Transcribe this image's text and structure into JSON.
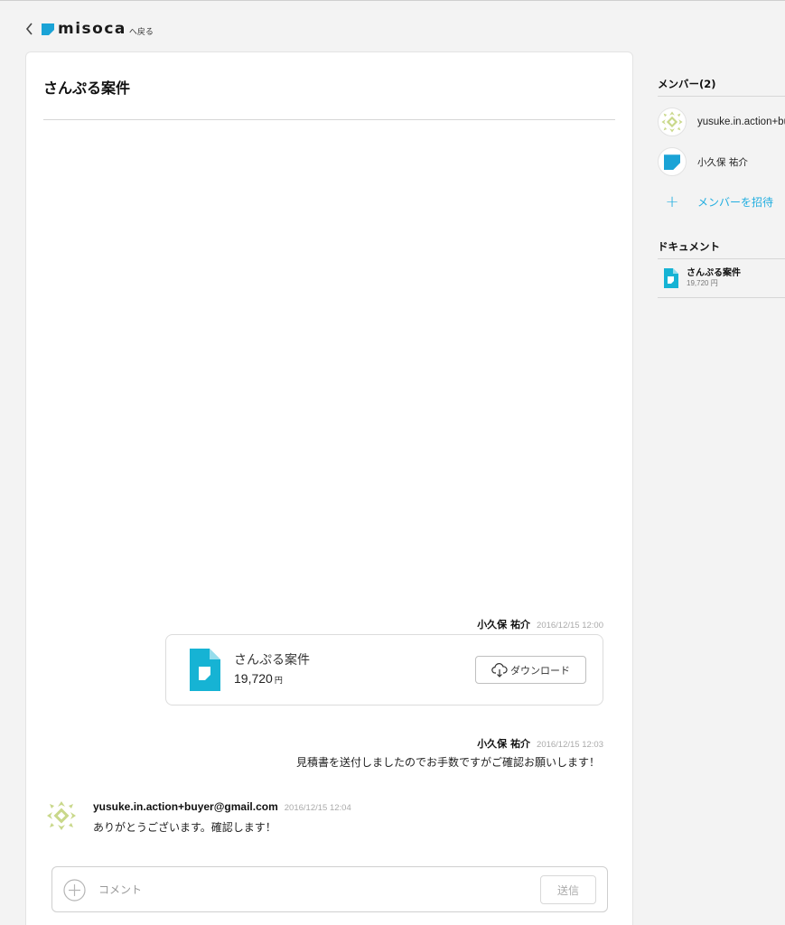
{
  "header": {
    "logo_text": "misoca",
    "back_label": "へ戻る"
  },
  "project": {
    "title": "さんぷる案件"
  },
  "messages": [
    {
      "author": "小久保 祐介",
      "timestamp": "2016/12/15 12:00",
      "attachment": {
        "name": "さんぷる案件",
        "amount": "19,720",
        "currency": "円",
        "download_label": "ダウンロード"
      }
    },
    {
      "author": "小久保 祐介",
      "timestamp": "2016/12/15 12:03",
      "text": "見積書を送付しましたのでお手数ですがご確認お願いします！"
    },
    {
      "author": "yusuke.in.action+buyer@gmail.com",
      "timestamp": "2016/12/15 12:04",
      "text": "ありがとうございます。確認します！"
    }
  ],
  "composer": {
    "placeholder": "コメント",
    "send_label": "送信"
  },
  "sidebar": {
    "members_heading": "メンバー(2)",
    "members": [
      {
        "name": "yusuke.in.action+buyer@gmail.com",
        "avatar": "pattern-avatar-icon"
      },
      {
        "name": "小久保 祐介",
        "avatar": "misoca-avatar-icon"
      }
    ],
    "invite_label": "メンバーを招待",
    "documents_heading": "ドキュメント",
    "documents": [
      {
        "name": "さんぷる案件",
        "amount": "19,720 円"
      }
    ]
  },
  "colors": {
    "accent": "#22aee0",
    "document_icon": "#16b3d4",
    "avatar_pattern": "#c9d88a"
  }
}
